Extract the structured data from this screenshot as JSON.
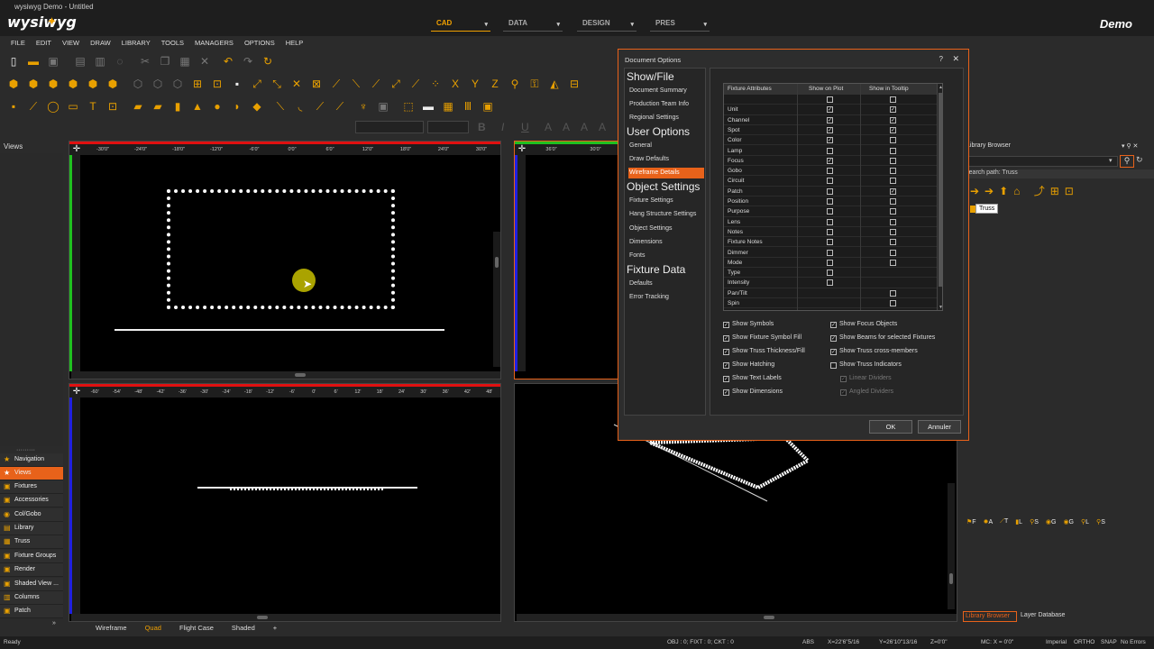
{
  "app": {
    "title": "wysiwyg Demo - Untitled",
    "logo": "wysiwyg",
    "demo_label": "Demo",
    "modes": [
      {
        "label": "CAD",
        "active": true
      },
      {
        "label": "DATA",
        "active": false
      },
      {
        "label": "DESIGN",
        "active": false
      },
      {
        "label": "PRES",
        "active": false
      }
    ]
  },
  "menu": [
    "FILE",
    "EDIT",
    "VIEW",
    "DRAW",
    "LIBRARY",
    "TOOLS",
    "MANAGERS",
    "OPTIONS",
    "HELP"
  ],
  "format_bar": {
    "bold": "B",
    "italic": "I",
    "underline": "U",
    "align_a1": "A",
    "align_a2": "A",
    "align_a3": "A",
    "align_a4": "A"
  },
  "left_panel": {
    "title": "Views",
    "items": [
      {
        "label": "Navigation",
        "icon": "star-icon",
        "active": false
      },
      {
        "label": "Views",
        "icon": "star-icon",
        "active": true
      },
      {
        "label": "Fixtures",
        "icon": "fixture-icon",
        "active": false
      },
      {
        "label": "Accessories",
        "icon": "accessory-icon",
        "active": false
      },
      {
        "label": "Col/Gobo",
        "icon": "gobo-icon",
        "active": false
      },
      {
        "label": "Library",
        "icon": "library-icon",
        "active": false
      },
      {
        "label": "Truss",
        "icon": "truss-icon",
        "active": false
      },
      {
        "label": "Fixture Groups",
        "icon": "group-icon",
        "active": false
      },
      {
        "label": "Render",
        "icon": "render-icon",
        "active": false
      },
      {
        "label": "Shaded View ...",
        "icon": "shaded-icon",
        "active": false
      },
      {
        "label": "Columns",
        "icon": "columns-icon",
        "active": false
      },
      {
        "label": "Patch",
        "icon": "patch-icon",
        "active": false
      }
    ]
  },
  "viewports": {
    "top_ruler": [
      "-30'0\"",
      "-24'0\"",
      "-18'0\"",
      "-12'0\"",
      "-6'0\"",
      "0'0\"",
      "6'0\"",
      "12'0\"",
      "18'0\"",
      "24'0\"",
      "30'0\"",
      "36'0\""
    ],
    "top_ruler_right": [
      "36'0\"",
      "30'0\""
    ],
    "bottom_ruler": [
      "-60'",
      "-54'",
      "-48'",
      "-42'",
      "-36'",
      "-30'",
      "-24'",
      "-18'",
      "-12'",
      "-6'",
      "0'",
      "6'",
      "12'",
      "18'",
      "24'",
      "30'",
      "36'",
      "42'",
      "48'"
    ]
  },
  "bottom_tabs": [
    {
      "label": "Wireframe",
      "active": false
    },
    {
      "label": "Quad",
      "active": true
    },
    {
      "label": "Flight Case",
      "active": false
    },
    {
      "label": "Shaded",
      "active": false
    },
    {
      "label": "+",
      "active": false
    }
  ],
  "status": {
    "ready": "Ready",
    "objects": "OBJ : 0; FIXT : 0; CKT : 0",
    "abs": "ABS",
    "x": "X=22'6\"5/16",
    "y": "Y=26'10\"13/16",
    "z": "Z=0'0\"",
    "mc": "MC: X = 0'0\"",
    "units": "Imperial",
    "ortho": "ORTHO",
    "snap": "SNAP",
    "errors": "No Errors"
  },
  "dialog": {
    "title": "Document Options",
    "help": "?",
    "close": "✕",
    "nav": [
      {
        "type": "head",
        "label": "Show/File"
      },
      {
        "type": "item",
        "label": "Document Summary"
      },
      {
        "type": "item",
        "label": "Production Team Info"
      },
      {
        "type": "item",
        "label": "Regional Settings"
      },
      {
        "type": "head",
        "label": "User Options"
      },
      {
        "type": "item",
        "label": "General"
      },
      {
        "type": "item",
        "label": "Draw Defaults"
      },
      {
        "type": "item",
        "label": "Wireframe Details",
        "active": true
      },
      {
        "type": "head",
        "label": "Object Settings"
      },
      {
        "type": "item",
        "label": "Fixture Settings"
      },
      {
        "type": "item",
        "label": "Hang Structure Settings"
      },
      {
        "type": "item",
        "label": "Object Settings"
      },
      {
        "type": "item",
        "label": "Dimensions"
      },
      {
        "type": "item",
        "label": "Fonts"
      },
      {
        "type": "head",
        "label": "Fixture Data"
      },
      {
        "type": "item",
        "label": "Defaults"
      },
      {
        "type": "item",
        "label": "Error Tracking"
      }
    ],
    "table_headers": [
      "Fixture Attributes",
      "Show on Plot",
      "Show in Tooltip"
    ],
    "attributes": [
      {
        "name": "",
        "plot": false,
        "tooltip": false
      },
      {
        "name": "Unit",
        "plot": true,
        "tooltip": true
      },
      {
        "name": "Channel",
        "plot": true,
        "tooltip": true
      },
      {
        "name": "Spot",
        "plot": true,
        "tooltip": true
      },
      {
        "name": "Color",
        "plot": true,
        "tooltip": false
      },
      {
        "name": "Lamp",
        "plot": false,
        "tooltip": false
      },
      {
        "name": "Focus",
        "plot": true,
        "tooltip": false
      },
      {
        "name": "Gobo",
        "plot": false,
        "tooltip": false
      },
      {
        "name": "Circuit",
        "plot": false,
        "tooltip": false
      },
      {
        "name": "Patch",
        "plot": false,
        "tooltip": true
      },
      {
        "name": "Position",
        "plot": false,
        "tooltip": false
      },
      {
        "name": "Purpose",
        "plot": false,
        "tooltip": false
      },
      {
        "name": "Lens",
        "plot": false,
        "tooltip": false
      },
      {
        "name": "Notes",
        "plot": false,
        "tooltip": false
      },
      {
        "name": "Fixture Notes",
        "plot": false,
        "tooltip": false
      },
      {
        "name": "Dimmer",
        "plot": false,
        "tooltip": false
      },
      {
        "name": "Mode",
        "plot": false,
        "tooltip": false
      },
      {
        "name": "Type",
        "plot": false,
        "tooltip": null
      },
      {
        "name": "Intensity",
        "plot": false,
        "tooltip": null
      },
      {
        "name": "Pan/Tilt",
        "plot": null,
        "tooltip": false
      },
      {
        "name": "Spin",
        "plot": null,
        "tooltip": false
      }
    ],
    "options_left": [
      {
        "label": "Show Symbols",
        "checked": true
      },
      {
        "label": "Show Fixture Symbol Fill",
        "checked": true
      },
      {
        "label": "Show Truss Thickness/Fill",
        "checked": true
      },
      {
        "label": "Show Hatching",
        "checked": true
      },
      {
        "label": "Show Text Labels",
        "checked": true
      },
      {
        "label": "Show Dimensions",
        "checked": true
      }
    ],
    "options_right": [
      {
        "label": "Show Focus Objects",
        "checked": true,
        "disabled": false
      },
      {
        "label": "Show Beams for selected Fixtures",
        "checked": true,
        "disabled": false
      },
      {
        "label": "Show Truss cross-members",
        "checked": true,
        "disabled": false
      },
      {
        "label": "Show Truss Indicators",
        "checked": false,
        "disabled": false
      },
      {
        "label": "Linear Dividers",
        "checked": true,
        "disabled": true
      },
      {
        "label": "Angled Dividers",
        "checked": true,
        "disabled": true
      }
    ],
    "ok": "OK",
    "cancel": "Annuler"
  },
  "library_browser": {
    "title": "Library Browser",
    "search_path": "Search path: Truss",
    "tooltip": "Truss",
    "tabs": [
      "Library Browser",
      "Layer Database"
    ],
    "filter_tabs": [
      "F",
      "A",
      "T",
      "L",
      "S",
      "G",
      "G",
      "L",
      "S"
    ]
  },
  "colors": {
    "accent": "#e8621a",
    "gold": "#f0a000",
    "ruler_red": "#e01010",
    "ruler_green": "#20c020"
  }
}
